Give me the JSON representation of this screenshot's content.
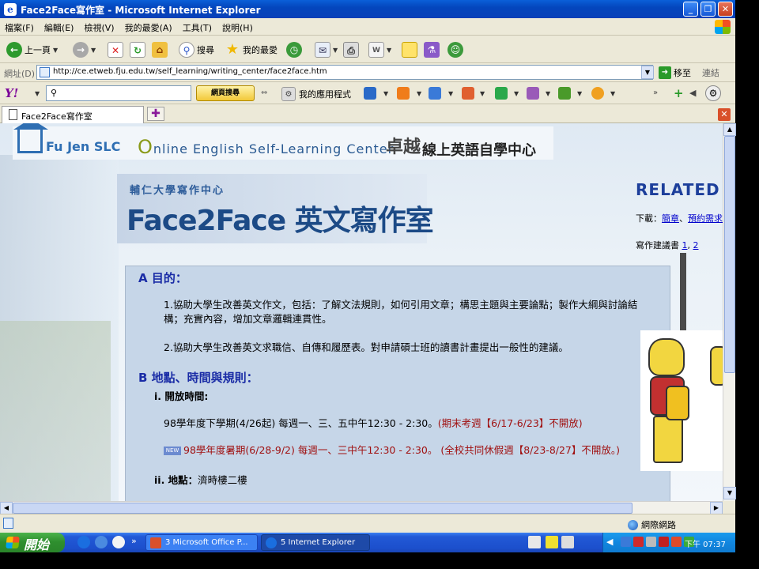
{
  "window": {
    "title": "Face2Face寫作室 - Microsoft Internet Explorer"
  },
  "menu": [
    "檔案(F)",
    "編輯(E)",
    "檢視(V)",
    "我的最愛(A)",
    "工具(T)",
    "說明(H)"
  ],
  "toolbar": {
    "back_label": "上一頁",
    "search_label": "搜尋",
    "favorites_label": "我的最愛"
  },
  "address": {
    "label": "網址(D)",
    "url": "http://ce.etweb.fju.edu.tw/self_learning/writing_center/face2face.htm",
    "go_label": "移至",
    "links_label": "連結"
  },
  "yahoo": {
    "logo": "Y!",
    "search_button": "網頁搜尋",
    "my_apps": "我的應用程式"
  },
  "tab": {
    "title": "Face2Face寫作室"
  },
  "page": {
    "header": {
      "fujen": "Fu Jen SLC",
      "o": "O",
      "english": "nline English Self-Learning Center",
      "zhuoyue": "卓越",
      "chinese": "線上英語自學中心"
    },
    "banner": {
      "center": "輔仁大學寫作中心",
      "title_a": "Face2Face",
      "title_b": " 英文寫作室"
    },
    "related": {
      "heading": "RELATED L",
      "download_label": "下載：",
      "download_link1": "簡章",
      "download_sep": "、",
      "download_link2": "預約需求",
      "guide_label": "寫作建議書 ",
      "guide_link1": "1",
      "guide_sep": ", ",
      "guide_link2": "2"
    },
    "sectionA": {
      "title": "A  目的：",
      "p1": "1.協助大學生改善英文作文，包括：了解文法規則，如何引用文章；構思主題與主要論點；製作大綱與討論結構；充實內容，增加文章邏輯連貫性。",
      "p2": "2.協助大學生改善英文求職信、自傳和履歷表。對申請碩士班的讀書計畫提出一般性的建議。"
    },
    "sectionB": {
      "title": "B  地點、時間與規則：",
      "i_title": "i. 開放時間:",
      "sched1_main": "98學年度下學期(4/26起) 每週一、三、五中午12:30  -  2:30。",
      "sched1_red": "(期末考週【6/17-6/23】不開放)",
      "new_badge": "NEW",
      "sched2_red1": "98學年度暑期",
      "sched2_red2": "(6/28-9/2) 每週一、三中午12:30  -  2:30。  (全校共同休假週【8/23-8/27】不開放。)",
      "ii_label": "ii. 地點：",
      "ii_value": "濟時樓二樓"
    }
  },
  "status": {
    "zone": "網際網路"
  },
  "taskbar": {
    "start": "開始",
    "task1": "3 Microsoft Office P...",
    "task2": "5 Internet Explorer",
    "clock": "下午 07:37"
  }
}
